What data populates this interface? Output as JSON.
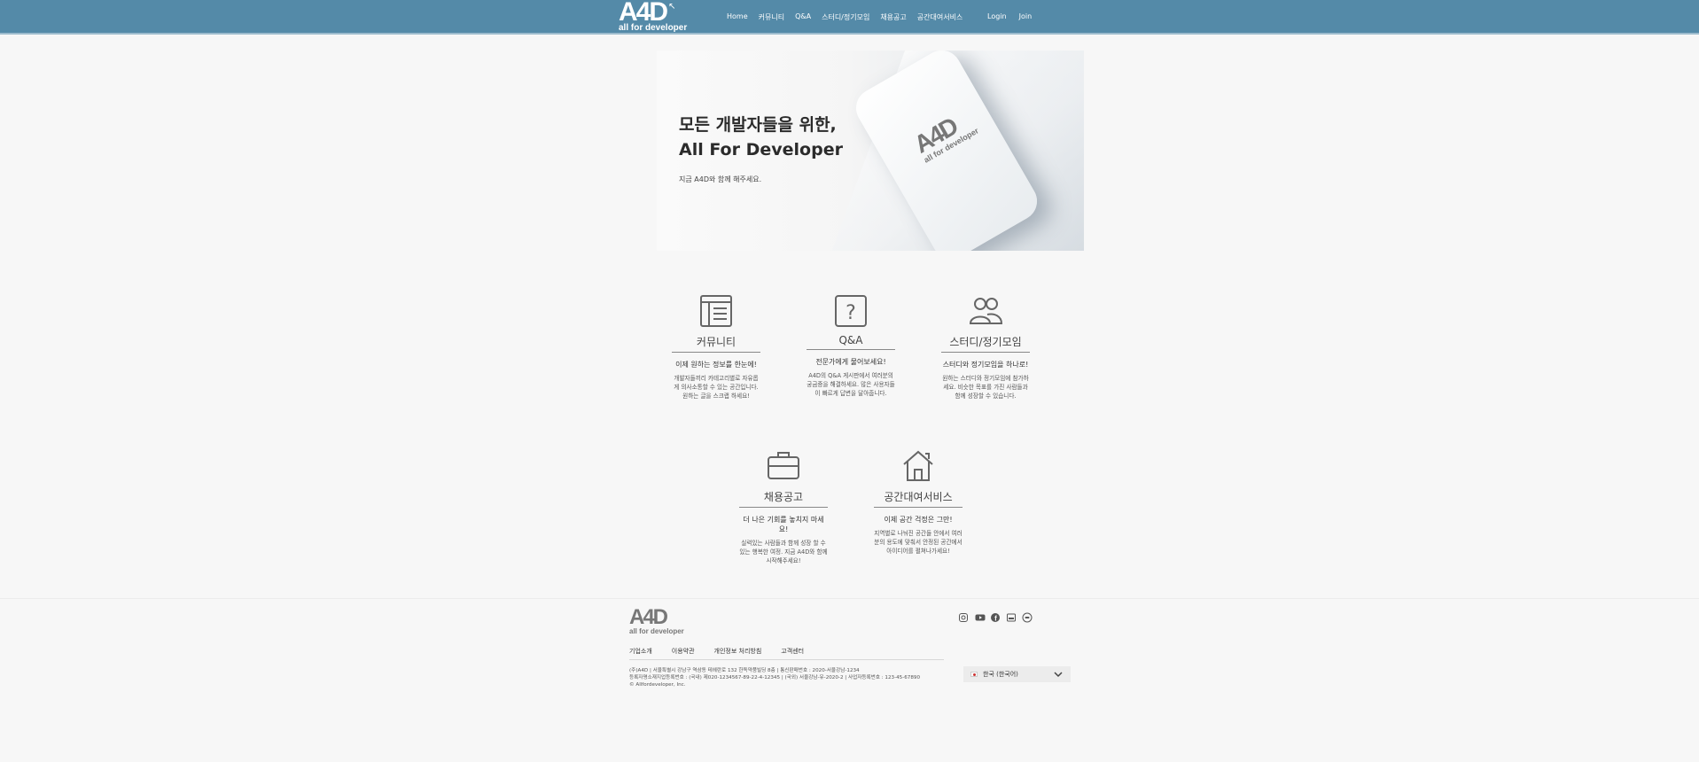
{
  "header": {
    "logo_big": "A4D",
    "logo_small": "all for developer",
    "nav": [
      "Home",
      "커뮤니티",
      "Q&A",
      "스터디/정기모임",
      "채용공고",
      "공간대여서비스"
    ],
    "login": "Login",
    "join": "Join"
  },
  "hero": {
    "title_line1": "모든 개발자들을 위한,",
    "title_line2": "All For Developer",
    "subtitle": "지금 A4D와 함께 해주세요.",
    "phone_logo_big": "A4D",
    "phone_logo_small": "all for developer"
  },
  "features": [
    {
      "icon": "document-icon",
      "title": "커뮤니티",
      "tag": "이제 원하는 정보를 한눈에!",
      "desc": "개발자들끼리 카테고리별로 자유롭게 의사소통할 수 있는 공간입니다. 원하는 글을 스크랩 하세요!"
    },
    {
      "icon": "question-icon",
      "title": "Q&A",
      "tag": "전문가에게 물어보세요!",
      "desc": "A4D의 Q&A 게시판에서 여러분의 궁금증을 해결하세요. 많은 사용자들이 빠르게 답변을 달아줍니다."
    },
    {
      "icon": "users-icon",
      "title": "스터디/정기모임",
      "tag": "스터디와 정기모임을 하나로!",
      "desc": "원하는 스터디와 정기모임에 참가하세요. 비슷한 목표를 가진 사람들과 함께 성장할 수 있습니다."
    },
    {
      "icon": "briefcase-icon",
      "title": "채용공고",
      "tag": "더 나은 기회를 놓치지 마세요!",
      "desc": "실력있는 사람들과 함께 성장 할 수 있는 행복한 여정. 지금 A4D와 함께 시작해주세요!"
    },
    {
      "icon": "home-icon",
      "title": "공간대여서비스",
      "tag": "이제 공간 걱정은 그만!",
      "desc": "지역별로 나눠진 공간들 안에서 여러분의 용도에 맞춰서 안정된 공간에서 아이디어를 펼쳐나가세요!"
    }
  ],
  "footer": {
    "logo_big": "A4D",
    "logo_small": "all for developer",
    "links": [
      "기업소개",
      "이용약관",
      "개인정보 처리방침",
      "고객센터"
    ],
    "info_line1": "(주)A4D | 서울특별시 강남구 역삼동 테헤란로 132 한독약품빌딩 8층 | 통신판매번호 : 2020-서울강남-1234",
    "info_line2": "등록자명소재지업등록번호 : (국내) 제020-1234567-89-22-4-12345 | (국외) 서울강남-유-2020-2 | 사업자등록번호 : 123-45-67890",
    "copyright": "© Allfordeveloper, Inc.",
    "language": "한국 (한국어)",
    "social": [
      "instagram-icon",
      "youtube-icon",
      "facebook-icon",
      "blog-icon",
      "kakao-icon"
    ]
  }
}
